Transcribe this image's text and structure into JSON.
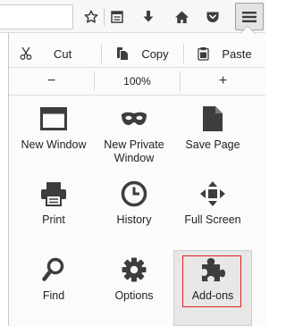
{
  "toolbar": {
    "icons": [
      "star-icon",
      "reading-list-icon",
      "download-icon",
      "home-icon",
      "pocket-icon",
      "hamburger-menu-icon"
    ]
  },
  "edit": {
    "cut": "Cut",
    "copy": "Copy",
    "paste": "Paste"
  },
  "zoom": {
    "minus": "−",
    "value": "100%",
    "plus": "+"
  },
  "tiles": {
    "new_window": "New Window",
    "new_private_window": "New Private Window",
    "save_page": "Save Page",
    "print": "Print",
    "history": "History",
    "full_screen": "Full Screen",
    "find": "Find",
    "options": "Options",
    "add_ons": "Add-ons"
  },
  "colors": {
    "icon": "#3d3d3d",
    "highlight": "#e01e1e",
    "selected_tile": "#e7e7e7"
  }
}
